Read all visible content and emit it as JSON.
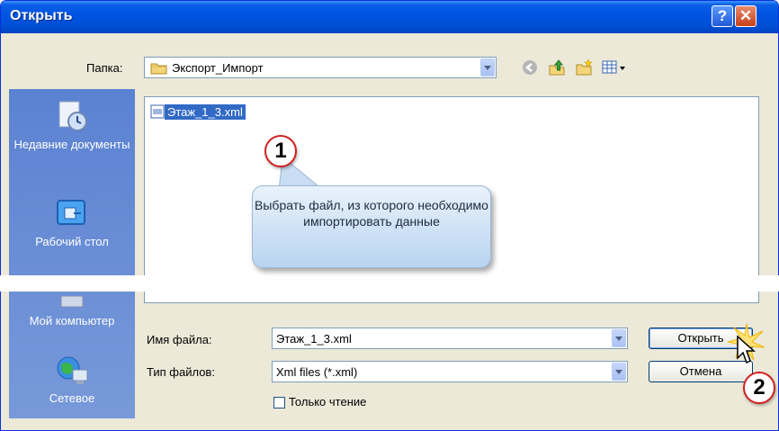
{
  "window": {
    "title": "Открыть",
    "help_glyph": "?",
    "close_glyph": "✕"
  },
  "folder": {
    "label": "Папка:",
    "value": "Экспорт_Импорт"
  },
  "toolbar": {
    "icons": [
      "back-icon",
      "up-folder-icon",
      "new-folder-icon",
      "view-menu-icon"
    ]
  },
  "places": [
    {
      "label": "Недавние документы",
      "icon": "recent-documents-icon"
    },
    {
      "label": "Рабочий стол",
      "icon": "desktop-icon"
    },
    {
      "label": "Мой компьютер",
      "icon": "my-computer-icon"
    },
    {
      "label": "Сетевое",
      "icon": "network-icon"
    }
  ],
  "files": [
    {
      "name": "Этаж_1_3.xml",
      "icon": "xml-file-icon",
      "selected": true
    }
  ],
  "filename": {
    "label": "Имя файла:",
    "value": "Этаж_1_3.xml"
  },
  "filetype": {
    "label": "Тип файлов:",
    "value": "Xml files (*.xml)"
  },
  "readonly": {
    "label": "Только чтение",
    "checked": false
  },
  "buttons": {
    "open": "Открыть",
    "cancel": "Отмена"
  },
  "annotations": {
    "callout_text": "Выбрать файл, из которого необходимо импортировать данные",
    "step1": "1",
    "step2": "2"
  },
  "colors": {
    "titlebar": "#0054e3",
    "selection": "#316ac5",
    "badge_border": "#d02020",
    "places_bar": "#6b8dcf"
  }
}
